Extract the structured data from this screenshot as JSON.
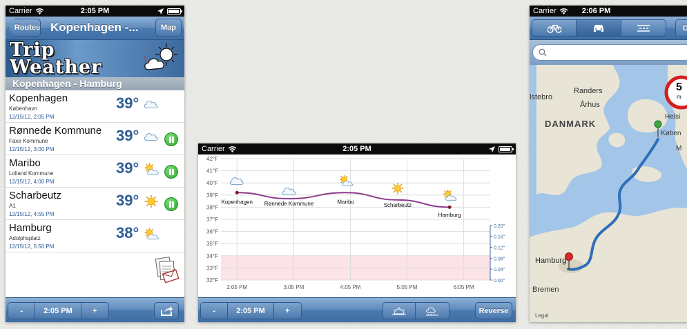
{
  "left_phone": {
    "status": {
      "carrier": "Carrier",
      "time": "2:05 PM"
    },
    "nav": {
      "back_label": "Routes",
      "title": "Kopenhagen -...",
      "map_label": "Map"
    },
    "banner": {
      "title_line1": "Trip",
      "title_line2": "Weather"
    },
    "section_header": "Kopenhagen - Hamburg",
    "rows": [
      {
        "name": "Kopenhagen",
        "sub": "København",
        "date": "12/15/12, 2:05 PM",
        "temp": "39°",
        "icon": "cloud-icon",
        "paused": false
      },
      {
        "name": "Rønnede Kommune",
        "sub": "Faxe Kommune",
        "date": "12/15/12, 3:00 PM",
        "temp": "39°",
        "icon": "cloud-icon",
        "paused": true
      },
      {
        "name": "Maribo",
        "sub": "Lolland Kommune",
        "date": "12/15/12, 4:00 PM",
        "temp": "39°",
        "icon": "sun-cloud-icon",
        "paused": true
      },
      {
        "name": "Scharbeutz",
        "sub": "A1",
        "date": "12/15/12, 4:55 PM",
        "temp": "39°",
        "icon": "sun-icon",
        "paused": true
      },
      {
        "name": "Hamburg",
        "sub": "Adolphsplatz",
        "date": "12/15/12, 5:50 PM",
        "temp": "38°",
        "icon": "sun-cloud-icon",
        "paused": false
      }
    ],
    "toolbar": {
      "minus": "-",
      "time": "2:05 PM",
      "plus": "+"
    }
  },
  "middle_phone": {
    "status": {
      "carrier": "Carrier",
      "time": "2:05 PM"
    },
    "toolbar": {
      "minus": "-",
      "time": "2:05 PM",
      "plus": "+",
      "reverse": "Reverse"
    }
  },
  "chart_data": {
    "type": "line",
    "x": [
      "2:05 PM",
      "3:05 PM",
      "4:05 PM",
      "5:05 PM",
      "6:05 PM"
    ],
    "y_left_ticks": [
      "32°F",
      "33°F",
      "34°F",
      "35°F",
      "36°F",
      "37°F",
      "38°F",
      "39°F",
      "40°F",
      "41°F",
      "42°F"
    ],
    "y_right_ticks": [
      "0.00\"",
      "0.04\"",
      "0.08\"",
      "0.12\"",
      "0.16\"",
      "0.20\""
    ],
    "ylim": [
      32,
      42
    ],
    "xlim_hours": [
      1.8,
      6.55
    ],
    "series": [
      {
        "values": [
          {
            "t": 2.083,
            "temp": 39.2,
            "label": "Kopenhagen",
            "icon": "cloud-icon",
            "marker": true
          },
          {
            "t": 3.0,
            "temp": 38.7,
            "label": "Rønnede Kommune",
            "icon": "cloud-icon",
            "marker": false
          },
          {
            "t": 4.0,
            "temp": 39.2,
            "label": "Maribo",
            "icon": "sun-cloud-icon",
            "marker": false
          },
          {
            "t": 4.917,
            "temp": 38.6,
            "label": "Scharbeutz",
            "icon": "sun-icon",
            "marker": false
          },
          {
            "t": 5.833,
            "temp": 38.0,
            "label": "Hamburg",
            "icon": "sun-cloud-icon",
            "marker": true
          }
        ]
      }
    ],
    "grid": true
  },
  "right_phone": {
    "status": {
      "carrier": "Carrier",
      "time": "2:06 PM"
    },
    "modes": [
      "bicycle-icon",
      "car-icon",
      "road-icon"
    ],
    "map_labels": {
      "country": "DANMARK",
      "city_randers": "Randers",
      "city_aarhus": "Århus",
      "city_holstebro": "lstebro",
      "city_helsi": "Helsi",
      "city_kob": "Køben",
      "city_hamburg": "Hamburg",
      "city_bremen": "Bremen",
      "legal": "Legal",
      "sign_number": "5",
      "sign_unit": "m",
      "side_m": "M",
      "nav_button": "D"
    }
  }
}
